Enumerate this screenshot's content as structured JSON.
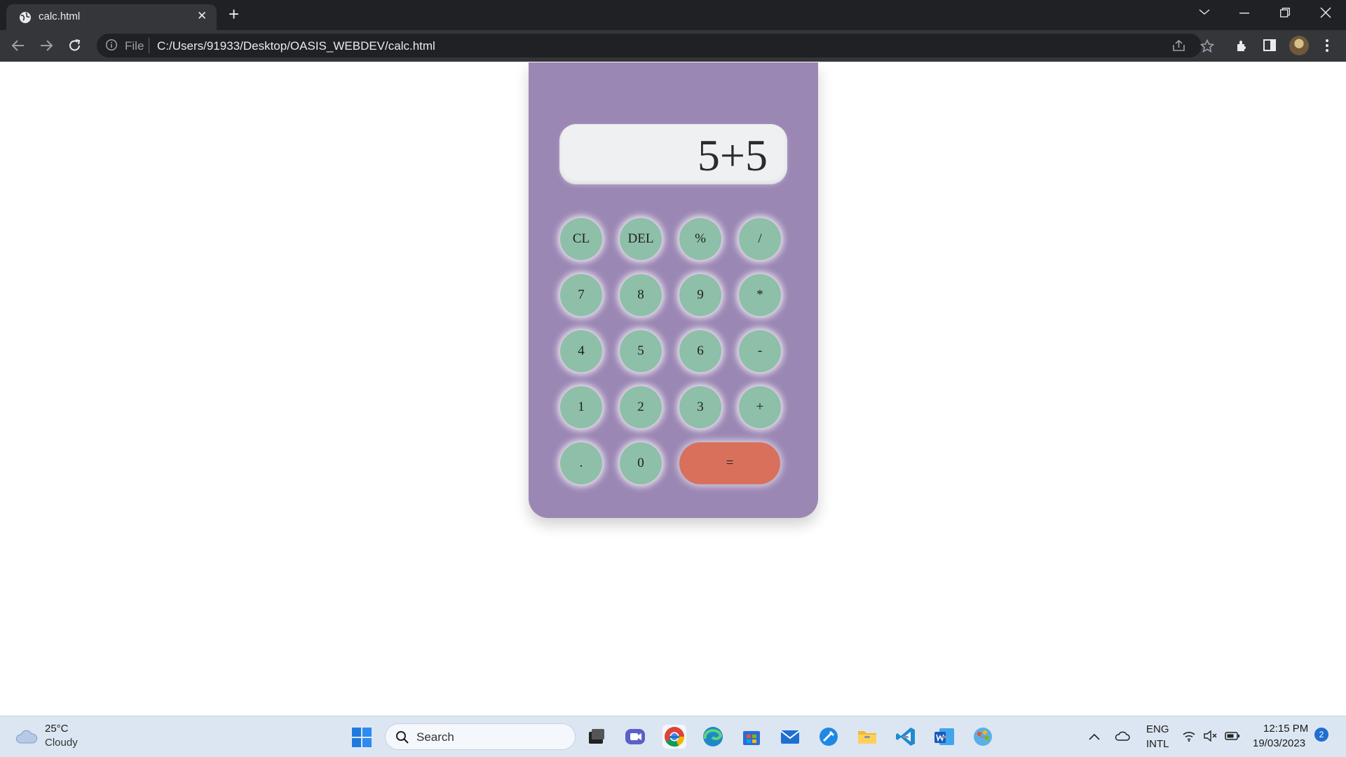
{
  "browser": {
    "tab_title": "calc.html",
    "url_scheme": "File",
    "url": "C:/Users/91933/Desktop/OASIS_WEBDEV/calc.html"
  },
  "calculator": {
    "display": "5+5",
    "keys": {
      "clear": "CL",
      "delete": "DEL",
      "percent": "%",
      "divide": "/",
      "seven": "7",
      "eight": "8",
      "nine": "9",
      "multiply": "*",
      "four": "4",
      "five": "5",
      "six": "6",
      "minus": "-",
      "one": "1",
      "two": "2",
      "three": "3",
      "plus": "+",
      "dot": ".",
      "zero": "0",
      "equals": "="
    },
    "colors": {
      "body": "#9b87b4",
      "key": "#8ebfa8",
      "equals": "#d8705c",
      "display": "#eef0f1"
    }
  },
  "taskbar": {
    "weather_temp": "25°C",
    "weather_condition": "Cloudy",
    "search_placeholder": "Search",
    "language": "ENG",
    "keyboard_layout": "INTL",
    "time": "12:15 PM",
    "date": "19/03/2023",
    "notification_count": "2",
    "apps": [
      "task-view",
      "teams-chat",
      "chrome",
      "edge",
      "microsoft-store",
      "mail",
      "tools",
      "file-explorer",
      "vscode",
      "word",
      "paint"
    ]
  }
}
